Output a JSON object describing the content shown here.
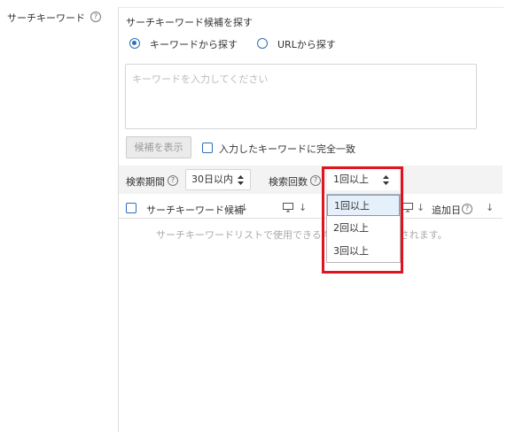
{
  "field_label": "サーチキーワード",
  "help_glyph": "?",
  "panel": {
    "title": "サーチキーワード候補を探す",
    "radio_keyword": "キーワードから探す",
    "radio_url": "URLから探す",
    "radio_selected": "keyword",
    "textarea_placeholder": "キーワードを入力してください",
    "show_candidates_button": "候補を表示",
    "exact_match_label": "入力したキーワードに完全一致"
  },
  "filters": {
    "period_label": "検索期間",
    "period_value": "30日以内",
    "count_label": "検索回数",
    "count_value": "1回以上"
  },
  "table": {
    "col_keyword": "サーチキーワード候補",
    "col_added_date": "追加日",
    "sort_arrow": "↓",
    "empty_message": "サーチキーワードリストで使用できるキーワードが表示されます。"
  },
  "dropdown": {
    "options": [
      "1回以上",
      "2回以上",
      "3回以上"
    ],
    "selected_index": 0
  },
  "colors": {
    "accent": "#2c6eb8",
    "highlight": "#e0141e",
    "selected_option_bg": "#e6f0fa"
  }
}
